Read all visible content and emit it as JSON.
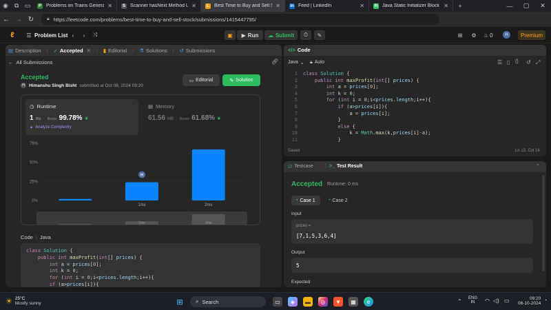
{
  "browser": {
    "tabs": [
      {
        "title": "Problems on Trains General Ques",
        "color": "#2e7d32",
        "fav": "P"
      },
      {
        "title": "Scanner hasNext Method Usage",
        "color": "#555555",
        "fav": "S"
      },
      {
        "title": "Best Time to Buy and Sell Stock",
        "color": "#f39c12",
        "fav": "L",
        "active": true
      },
      {
        "title": "Feed | LinkedIn",
        "color": "#0a66c2",
        "fav": "in"
      },
      {
        "title": "Java Static Initializer Block | Hack",
        "color": "#2ec866",
        "fav": "H"
      }
    ],
    "url": "https://leetcode.com/problems/best-time-to-buy-and-sell-stock/submissions/1415447795/"
  },
  "lcnav": {
    "problem_list": "Problem List",
    "run": "Run",
    "submit": "Submit",
    "streak": "0",
    "avatar": "H",
    "premium": "Premium"
  },
  "left": {
    "tabs": [
      "Description",
      "Accepted",
      "Editorial",
      "Solutions",
      "Submissions"
    ],
    "all_submissions": "All Submissions",
    "status": "Accepted",
    "user_initial": "H",
    "user": "Himanshu Singh Bisht",
    "submitted": "submitted at Oct 08, 2024 09:20",
    "editorial_btn": "Editorial",
    "solution_btn": "Solution",
    "runtime_label": "Runtime",
    "runtime_value": "1",
    "runtime_unit": "ms",
    "beats_label": "Beats",
    "runtime_beats": "99.78%",
    "analyze": "Analyze Complexity",
    "memory_label": "Memory",
    "memory_value": "61.56",
    "memory_unit": "MB",
    "memory_beats": "61.68%",
    "code_label": "Code",
    "lang": "Java"
  },
  "chart_data": {
    "type": "bar",
    "yticks": [
      "75%",
      "50%",
      "25%",
      "0%"
    ],
    "ylim": [
      0,
      75
    ],
    "categories": [
      "",
      "1ms",
      "2ms"
    ],
    "values": [
      2,
      24,
      67
    ],
    "marker": "H",
    "marker_category": "1ms"
  },
  "left_code": [
    "class Solution {",
    "    public int maxProfit(int[] prices) {",
    "        int a = prices[0];",
    "        int k = 0;",
    "        for (int i = 0;i<prices.length;i++){",
    "        if (a>prices[i]){"
  ],
  "code": {
    "title": "Code",
    "lang": "Java",
    "auto": "Auto",
    "lines": [
      "class Solution {",
      "    public int maxProfit(int[] prices) {",
      "        int a = prices[0];",
      "        int k = 0;",
      "        for (int i = 0;i<prices.length;i++){",
      "            if (a>prices[i]){",
      "                a = prices[i];",
      "            }",
      "            else {",
      "                k = Math.max(k,prices[i]-a);",
      "            }"
    ],
    "saved": "Saved",
    "cursor": "Ln 13, Col 16"
  },
  "result": {
    "testcase_tab": "Testcase",
    "result_tab": "Test Result",
    "status": "Accepted",
    "runtime": "Runtime: 0 ms",
    "case1": "Case 1",
    "case2": "Case 2",
    "input_label": "Input",
    "input_var": "prices =",
    "input_value": "[7,1,5,3,6,4]",
    "output_label": "Output",
    "output_value": "5",
    "expected_label": "Expected"
  },
  "taskbar": {
    "temp": "25°C",
    "weather": "Mostly sunny",
    "search": "Search",
    "lang1": "ENG",
    "lang2": "IN",
    "time": "09:20",
    "date": "08-10-2024"
  }
}
